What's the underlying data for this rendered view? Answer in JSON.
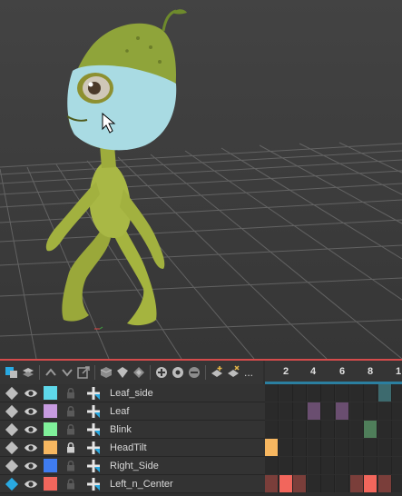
{
  "icons": {
    "toolbar": [
      "layer-link-icon",
      "layer-group-icon",
      "move-up-icon",
      "move-down-icon",
      "export-icon",
      "object-icon",
      "sphere-icon",
      "material-icon",
      "add-icon",
      "gear-icon",
      "remove-icon",
      "keyframe-add-icon",
      "keyframe-clear-icon"
    ],
    "eye": "eye-icon",
    "lock": "lock-icon",
    "plus": "move-icon",
    "diamond": "diamond-icon"
  },
  "toolbar": {
    "more_label": "..."
  },
  "ruler": {
    "ticks": [
      "2",
      "4",
      "6",
      "8",
      "1"
    ]
  },
  "layers": [
    {
      "name": "Leaf_side",
      "color": "#5ed8ea",
      "locked": false,
      "active": false
    },
    {
      "name": "Leaf",
      "color": "#c79be0",
      "locked": false,
      "active": false
    },
    {
      "name": "Blink",
      "color": "#7ff09a",
      "locked": false,
      "active": false
    },
    {
      "name": "HeadTilt",
      "color": "#f7b760",
      "locked": true,
      "active": false
    },
    {
      "name": "Right_Side",
      "color": "#3f7cf1",
      "locked": false,
      "active": false
    },
    {
      "name": "Left_n_Center",
      "color": "#f2665c",
      "locked": false,
      "active": true
    }
  ],
  "keyframes": [
    {
      "row": 0,
      "col": 8,
      "color": "#3d6a6e"
    },
    {
      "row": 1,
      "col": 3,
      "color": "#6a4e70"
    },
    {
      "row": 1,
      "col": 5,
      "color": "#6a4e70"
    },
    {
      "row": 2,
      "col": 7,
      "color": "#4f7e5a"
    },
    {
      "row": 3,
      "col": 0,
      "color": "#f7b760"
    },
    {
      "row": 5,
      "col": 0,
      "color": "#7a3e3a"
    },
    {
      "row": 5,
      "col": 1,
      "color": "#f2665c"
    },
    {
      "row": 5,
      "col": 2,
      "color": "#7a3e3a"
    },
    {
      "row": 5,
      "col": 6,
      "color": "#7a3e3a"
    },
    {
      "row": 5,
      "col": 7,
      "color": "#f2665c"
    },
    {
      "row": 5,
      "col": 8,
      "color": "#7a3e3a"
    }
  ],
  "colors": {
    "accent": "#29a9e1",
    "panel_border": "#d64b4b",
    "ruler_bar": "#2b7fa0"
  }
}
